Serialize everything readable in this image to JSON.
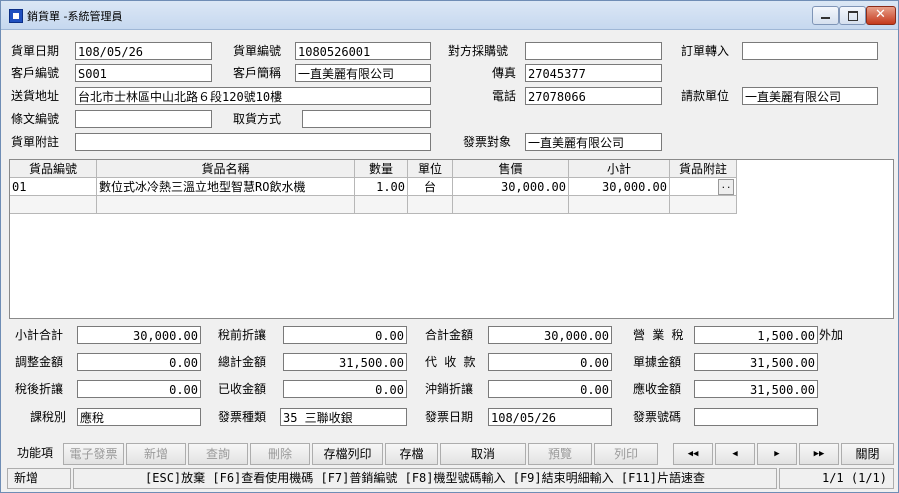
{
  "window": {
    "title": "銷貨單 -系統管理員"
  },
  "header": {
    "invoice_date_label": "貨單日期",
    "invoice_date": "108/05/26",
    "invoice_no_label": "貨單編號",
    "invoice_no": "1080526001",
    "po_no_label": "對方採購號",
    "po_no": "",
    "order_import_label": "訂單轉入",
    "order_import": "",
    "customer_code_label": "客戶編號",
    "customer_code": "S001",
    "customer_short_label": "客戶簡稱",
    "customer_short": "一直美麗有限公司",
    "fax_label": "傳真",
    "fax": "27045377",
    "delivery_addr_label": "送貨地址",
    "delivery_addr": "台北市士林區中山北路６段120號10樓",
    "phone_label": "電話",
    "phone": "27078066",
    "billing_unit_label": "請款單位",
    "billing_unit": "一直美麗有限公司",
    "clause_code_label": "條文編號",
    "clause_code": "",
    "pickup_label": "取貨方式",
    "pickup": "",
    "remark_label": "貨單附註",
    "remark": "",
    "invoice_target_label": "發票對象",
    "invoice_target": "一直美麗有限公司"
  },
  "items": {
    "columns": [
      "貨品編號",
      "貨品名稱",
      "數量",
      "單位",
      "售價",
      "小計",
      "貨品附註"
    ],
    "rows": [
      [
        "01",
        "數位式冰冷熱三溫立地型智慧RO飲水機",
        "1.00",
        "台",
        "30,000.00",
        "30,000.00",
        ""
      ]
    ]
  },
  "totals": {
    "subtotal_label": "小計合計",
    "subtotal": "30,000.00",
    "pre_tax_discount_label": "稅前折讓",
    "pre_tax_discount": "0.00",
    "total_amount_label": "合計金額",
    "total_amount": "30,000.00",
    "business_tax_label": "營 業 稅",
    "business_tax": "1,500.00",
    "tax_mode": "外加",
    "adjust_label": "調整金額",
    "adjust": "0.00",
    "grand_total_label": "總計金額",
    "grand_total": "31,500.00",
    "collect_label": "代 收 款",
    "collect": "0.00",
    "doc_amount_label": "單據金額",
    "doc_amount": "31,500.00",
    "after_tax_discount_label": "稅後折讓",
    "after_tax_discount": "0.00",
    "received_label": "已收金額",
    "received": "0.00",
    "writeoff_label": "沖銷折讓",
    "writeoff": "0.00",
    "receivable_label": "應收金額",
    "receivable": "31,500.00",
    "tax_type_label": "課稅別",
    "tax_type": "應稅",
    "invoice_kind_label": "發票種類",
    "invoice_kind": "35 三聯收銀",
    "invoice_date_label": "發票日期",
    "invoice_date": "108/05/26",
    "invoice_number_label": "發票號碼",
    "invoice_number": ""
  },
  "toolbar": {
    "function_label": "功能項",
    "e_invoice": "電子發票",
    "add": "新增",
    "query": "查詢",
    "delete": "刪除",
    "save_print": "存檔列印",
    "save": "存檔",
    "cancel": "取消",
    "preview": "預覽",
    "print": "列印",
    "first": "◀◀",
    "prev": "◀",
    "next": "▶",
    "last": "▶▶",
    "close": "關閉"
  },
  "status": {
    "mode": "新增",
    "hint": "[ESC]放棄 [F6]查看使用機碼 [F7]普銷編號 [F8]機型號碼輸入 [F9]結束明細輸入 [F11]片語速查",
    "page": "1/1 (1/1)"
  }
}
